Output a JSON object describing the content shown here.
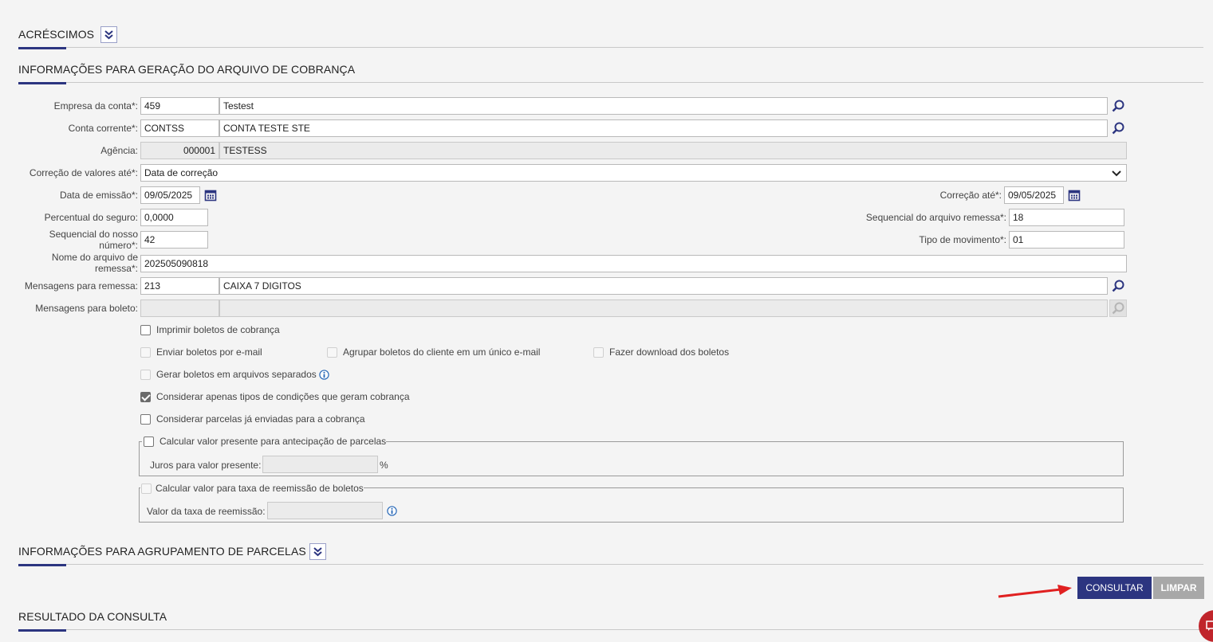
{
  "sections": {
    "acrescimos": "ACRÉSCIMOS",
    "info_geracao": "INFORMAÇÕES PARA GERAÇÃO DO ARQUIVO DE COBRANÇA",
    "info_agrupamento": "INFORMAÇÕES PARA AGRUPAMENTO DE PARCELAS",
    "resultado": "RESULTADO DA CONSULTA"
  },
  "form": {
    "empresa": {
      "label": "Empresa da conta*:",
      "code": "459",
      "name": "Testest"
    },
    "conta": {
      "label": "Conta corrente*:",
      "code": "CONTSS",
      "name": "CONTA TESTE STE"
    },
    "agencia": {
      "label": "Agência:",
      "code": "000001",
      "name": "TESTESS"
    },
    "correcao_valores": {
      "label": "Correção de valores até*:",
      "value": "Data de correção"
    },
    "data_emissao": {
      "label": "Data de emissão*:",
      "value": "09/05/2025"
    },
    "correcao_ate": {
      "label": "Correção até*:",
      "value": "09/05/2025"
    },
    "percentual_seguro": {
      "label": "Percentual do seguro:",
      "value": "0,0000"
    },
    "seq_arquivo_remessa": {
      "label": "Sequencial do arquivo remessa*:",
      "value": "18"
    },
    "seq_nosso_numero": {
      "label_line1": "Sequencial do nosso",
      "label_line2": "número*:",
      "value": "42"
    },
    "tipo_movimento": {
      "label": "Tipo de movimento*:",
      "value": "01"
    },
    "nome_arquivo": {
      "label_line1": "Nome do arquivo de",
      "label_line2": "remessa*:",
      "value": "202505090818"
    },
    "msg_remessa": {
      "label": "Mensagens para remessa:",
      "code": "213",
      "name": "CAIXA 7 DIGITOS"
    },
    "msg_boleto": {
      "label": "Mensagens para boleto:",
      "code": "",
      "name": ""
    }
  },
  "checkboxes": {
    "imprimir": {
      "label": "Imprimir boletos de cobrança",
      "checked": false
    },
    "enviar_email": {
      "label": "Enviar boletos por e-mail",
      "checked": false
    },
    "agrupar": {
      "label": "Agrupar boletos do cliente em um único e-mail",
      "checked": false
    },
    "download": {
      "label": "Fazer download dos boletos",
      "checked": false
    },
    "gerar_separados": {
      "label": "Gerar boletos em arquivos separados",
      "checked": false
    },
    "considerar_tipos": {
      "label": "Considerar apenas tipos de condições que geram cobrança",
      "checked": true
    },
    "considerar_parcelas": {
      "label": "Considerar parcelas já enviadas para a cobrança",
      "checked": false
    }
  },
  "valor_presente": {
    "legend": "Calcular valor presente para antecipação de parcelas",
    "juros_label": "Juros para valor presente:",
    "juros_value": "",
    "unit": "%"
  },
  "taxa_reemissao": {
    "legend": "Calcular valor para taxa de reemissão de boletos",
    "valor_label": "Valor da taxa de reemissão:",
    "valor_value": ""
  },
  "buttons": {
    "consultar": "CONSULTAR",
    "limpar": "LIMPAR"
  },
  "colors": {
    "primary": "#2c3580",
    "disabled": "#a8a8a8",
    "arrow": "#e02020"
  }
}
